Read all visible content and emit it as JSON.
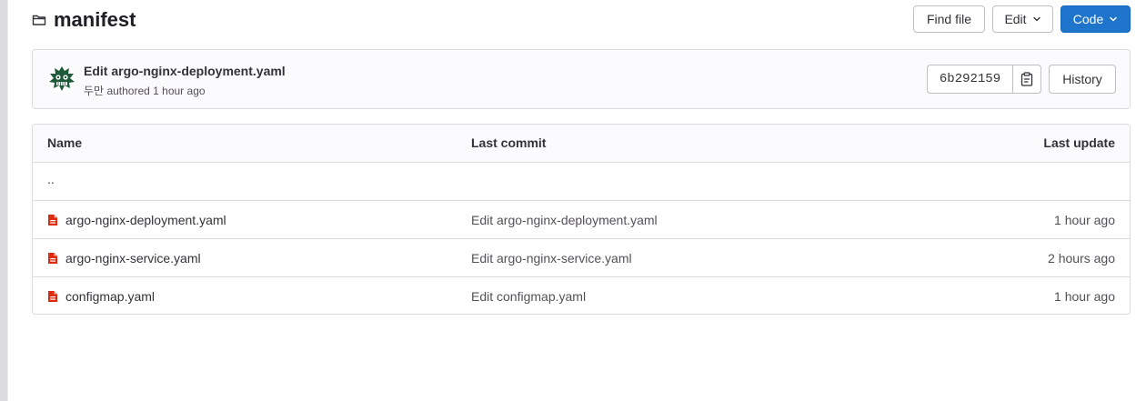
{
  "header": {
    "title": "manifest",
    "folder_icon": "folder-icon",
    "buttons": {
      "find_file": "Find file",
      "edit": "Edit",
      "code": "Code"
    }
  },
  "commit": {
    "title": "Edit argo-nginx-deployment.yaml",
    "author": "두만",
    "authored_text": "authored",
    "time": "1 hour ago",
    "sha": "6b292159",
    "history_label": "History"
  },
  "table": {
    "headers": {
      "name": "Name",
      "last_commit": "Last commit",
      "last_update": "Last update"
    },
    "parent": "..",
    "rows": [
      {
        "name": "argo-nginx-deployment.yaml",
        "commit": "Edit argo-nginx-deployment.yaml",
        "updated": "1 hour ago",
        "icon": "yaml-file-icon"
      },
      {
        "name": "argo-nginx-service.yaml",
        "commit": "Edit argo-nginx-service.yaml",
        "updated": "2 hours ago",
        "icon": "yaml-file-icon"
      },
      {
        "name": "configmap.yaml",
        "commit": "Edit configmap.yaml",
        "updated": "1 hour ago",
        "icon": "yaml-file-icon"
      }
    ]
  },
  "colors": {
    "primary": "#1f75cb",
    "file_icon": "#dd2b0e",
    "border": "#dcdcde",
    "avatar": "#1e5a38"
  }
}
